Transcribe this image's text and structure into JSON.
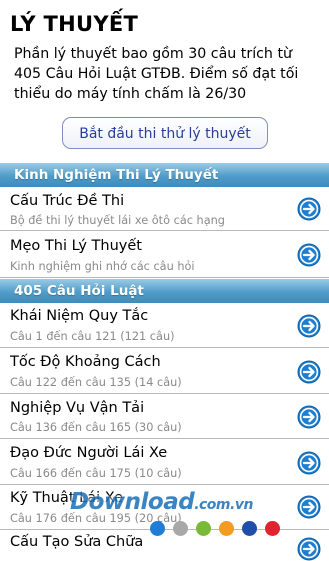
{
  "page": {
    "title": "LÝ THUYẾT",
    "intro": "Phần lý thuyết bao gồm 30 câu trích từ 405 Câu Hỏi Luật GTĐB. Điểm số đạt tối thiểu do máy tính chấm là 26/30",
    "start_button": "Bắt đầu thi thử lý thuyết"
  },
  "sections": [
    {
      "header": "Kinh Nghiệm Thi Lý Thuyết",
      "items": [
        {
          "title": "Cấu Trúc Đề Thi",
          "subtitle": "Bộ đề thi lý thuyết lái xe ôtô các hạng"
        },
        {
          "title": "Mẹo Thi Lý Thuyết",
          "subtitle": "Kinh nghiệm ghi nhớ các câu hỏi"
        }
      ]
    },
    {
      "header": "405 Câu Hỏi Luật",
      "items": [
        {
          "title": "Khái Niệm Quy Tắc",
          "subtitle": "Câu 1 đến câu 121 (121 câu)"
        },
        {
          "title": "Tốc Độ Khoảng Cách",
          "subtitle": "Câu 122 đến câu 135 (14 câu)"
        },
        {
          "title": "Nghiệp Vụ Vận Tải",
          "subtitle": "Câu 136 đến câu 165 (30 câu)"
        },
        {
          "title": "Đạo Đức Người Lái Xe",
          "subtitle": "Câu 166 đến câu 175 (10 câu)"
        },
        {
          "title": "Kỹ Thuật Lái Xe",
          "subtitle": "Câu 176 đến câu 195 (20 câu)"
        },
        {
          "title": "Cấu Tạo Sửa Chữa",
          "subtitle": ""
        }
      ]
    }
  ],
  "icons": {
    "row_arrow": "arrow-right-circle-icon"
  },
  "watermark": {
    "main": "Download",
    "suffix": ".com.vn"
  },
  "colors": {
    "section_header": "#4f9cc9",
    "arrow": "#1e7fd0",
    "button_text": "#283f9a",
    "dots": [
      "#1f7dd6",
      "#a8a8a8",
      "#7ab838",
      "#f39c1f",
      "#1f4fa8",
      "#e0232e"
    ]
  }
}
